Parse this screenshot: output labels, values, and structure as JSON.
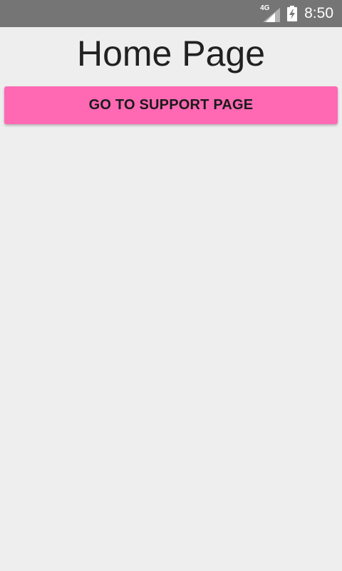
{
  "status_bar": {
    "network_label": "4G",
    "time": "8:50",
    "icons": [
      "signal-icon",
      "battery-charging-icon"
    ]
  },
  "main": {
    "title": "Home Page",
    "support_button_label": "GO TO SUPPORT PAGE"
  },
  "colors": {
    "status_bar_bg": "#757575",
    "page_bg": "#eeeeee",
    "button_bg": "#ff69b4",
    "text": "#212121"
  }
}
